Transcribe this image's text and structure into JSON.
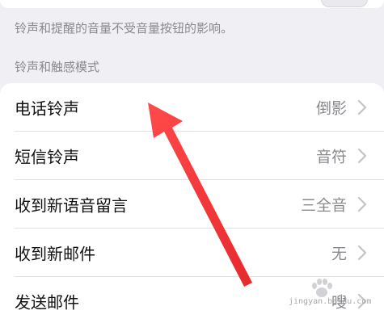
{
  "info_note": "铃声和提醒的音量不受音量按钮的影响。",
  "section_header": "铃声和触感模式",
  "rows": [
    {
      "label": "电话铃声",
      "value": "倒影"
    },
    {
      "label": "短信铃声",
      "value": "音符"
    },
    {
      "label": "收到新语音留言",
      "value": "三全音"
    },
    {
      "label": "收到新邮件",
      "value": "无"
    },
    {
      "label": "发送邮件",
      "value": "嗖"
    }
  ],
  "watermark": {
    "text": "jingyan.baidu.com"
  },
  "colors": {
    "background": "#efeff4",
    "card": "#ffffff",
    "label": "#111111",
    "secondary": "#8a8a8e",
    "annotation_arrow": "#f2373a"
  },
  "icons": {
    "row_chevron": "chevron-right-icon",
    "annotation": "red-arrow-icon",
    "watermark": "baidu-paw-icon"
  }
}
